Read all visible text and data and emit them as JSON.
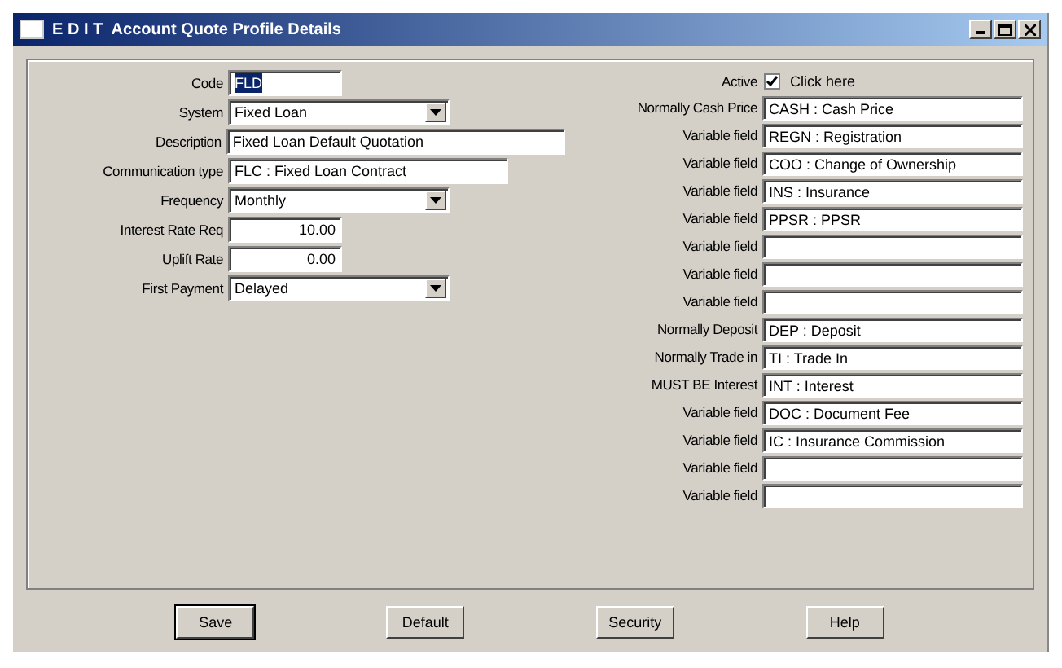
{
  "window": {
    "title": "E D I T  Account Quote Profile Details"
  },
  "left_fields": [
    {
      "kind": "text",
      "label": "Code",
      "value": "FLD",
      "highlighted": true
    },
    {
      "kind": "combo",
      "label": "System",
      "value": "Fixed Loan"
    },
    {
      "kind": "text",
      "label": "Description",
      "value": "Fixed Loan Default Quotation",
      "highlighted": false
    },
    {
      "kind": "text",
      "label": "Communication type",
      "value": "FLC : Fixed Loan Contract",
      "highlighted": false
    },
    {
      "kind": "combo",
      "label": "Frequency",
      "value": "Monthly"
    },
    {
      "kind": "number",
      "label": "Interest Rate Req",
      "value": "10.00",
      "highlighted": false
    },
    {
      "kind": "number",
      "label": "Uplift Rate",
      "value": "0.00",
      "highlighted": false
    },
    {
      "kind": "combo",
      "label": "First Payment",
      "value": "Delayed"
    }
  ],
  "active": {
    "label": "Active",
    "checked": true,
    "hint": "Click here"
  },
  "right_fields": [
    {
      "label": "Normally Cash Price",
      "value": "CASH : Cash Price"
    },
    {
      "label": "Variable field",
      "value": "REGN : Registration"
    },
    {
      "label": "Variable field",
      "value": "COO : Change of Ownership"
    },
    {
      "label": "Variable field",
      "value": "INS : Insurance"
    },
    {
      "label": "Variable field",
      "value": "PPSR : PPSR"
    },
    {
      "label": "Variable field"
    },
    {
      "label": "Variable field"
    },
    {
      "label": "Variable field"
    },
    {
      "label": "Normally Deposit",
      "value": "DEP : Deposit"
    },
    {
      "label": "Normally Trade in",
      "value": "TI : Trade In"
    },
    {
      "label": "MUST BE Interest",
      "value": "INT : Interest"
    },
    {
      "label": "Variable field",
      "value": "DOC : Document Fee"
    },
    {
      "label": "Variable field",
      "value": "IC : Insurance Commission"
    },
    {
      "label": "Variable field"
    },
    {
      "label": "Variable field"
    }
  ],
  "buttons": [
    {
      "label": "Save",
      "default": true
    },
    {
      "label": "Default",
      "default": false
    },
    {
      "label": "Security",
      "default": false
    },
    {
      "label": "Help",
      "default": false
    }
  ]
}
